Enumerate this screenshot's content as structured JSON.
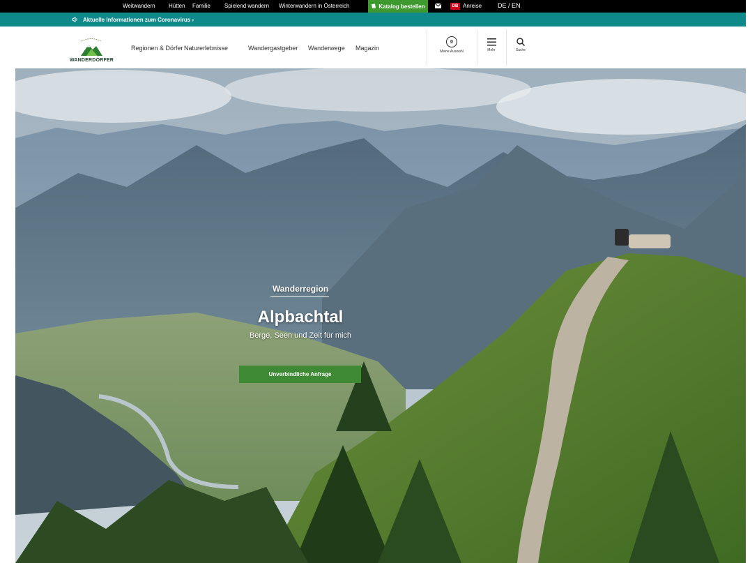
{
  "topbar": {
    "links": [
      "Weitwandern",
      "Hütten",
      "Familie",
      "Spielend wandern",
      "Winterwandern in Österreich"
    ],
    "catalog_label": "Katalog bestellen",
    "db_badge": "DB",
    "arrival_label": "Anreise",
    "lang_label": "DE / EN"
  },
  "infobar": {
    "text": "Aktuelle Informationen zum Coronavirus  ›"
  },
  "header": {
    "logo_text": "WANDERDÖRFER",
    "nav": [
      "Regionen & Dörfer",
      "Naturerlebnisse",
      "Wandergastgeber",
      "Wanderwege",
      "Magazin"
    ],
    "my_choice_count": "0",
    "my_choice_label": "Meine Auswahl",
    "more_label": "Mehr",
    "search_label": "Suche"
  },
  "hero": {
    "eyebrow": "Wanderregion",
    "title": "Alpbachtal",
    "subtitle": "Berge, Seen und Zeit für mich",
    "cta_label": "Unverbindliche Anfrage"
  },
  "colors": {
    "topbar": "#000000",
    "catalog": "#3e9a2e",
    "infobar": "#0e8a8a",
    "cta": "#3e8a34",
    "db": "#d0021b"
  }
}
